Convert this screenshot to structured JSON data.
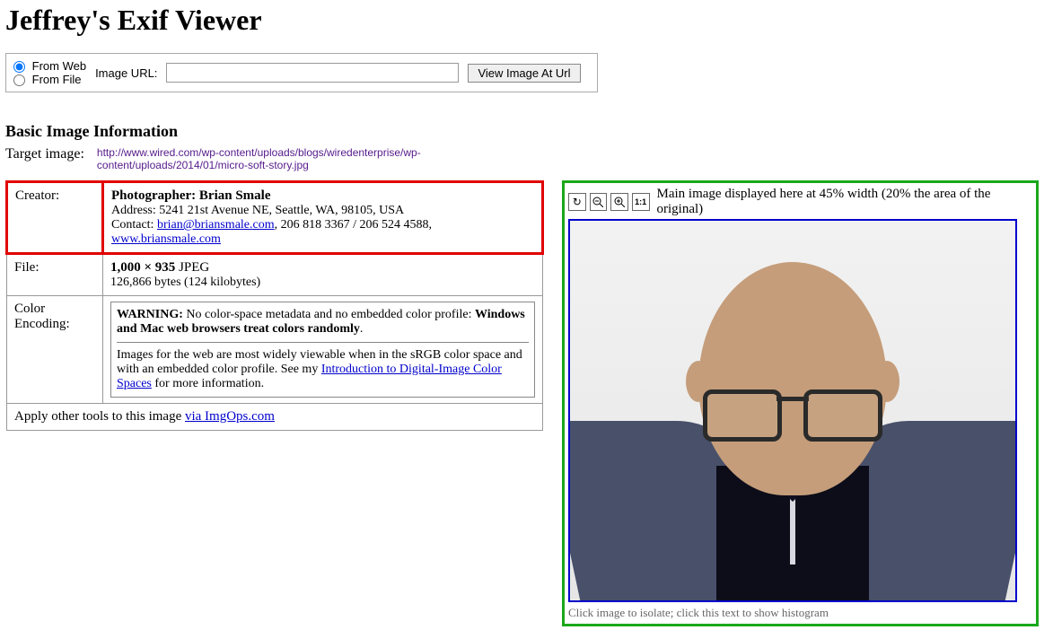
{
  "title": "Jeffrey's Exif Viewer",
  "source": {
    "from_web": "From Web",
    "from_file": "From File",
    "url_label": "Image URL:",
    "button": "View Image At Url"
  },
  "section_title": "Basic Image Information",
  "target": {
    "label": "Target image:",
    "url": "http://www.wired.com/wp-content/uploads/blogs/wiredenterprise/wp-content/uploads/2014/01/micro-soft-story.jpg"
  },
  "rows": {
    "creator": {
      "key": "Creator:",
      "photographer_label": "Photographer: Brian Smale",
      "address": "Address: 5241 21st Avenue NE, Seattle, WA, 98105, USA",
      "contact_prefix": "Contact: ",
      "email": "brian@briansmale.com",
      "phones": ", 206 818 3367 / 206 524 4588, ",
      "site": "www.briansmale.com"
    },
    "file": {
      "key": "File:",
      "dims": "1,000 × 935",
      "dims_suffix": " JPEG",
      "bytes": "126,866 bytes (124 kilobytes)"
    },
    "color": {
      "key": "Color Encoding:",
      "warn_bold1": "WARNING:",
      "warn_text1": " No color-space metadata and no embedded color profile: ",
      "warn_bold2": "Windows and Mac web browsers treat colors randomly",
      "period": ".",
      "body_pre": "Images for the web are most widely viewable when in the sRGB color space and with an embedded color profile. See my ",
      "body_link": "Introduction to Digital-Image Color Spaces",
      "body_post": " for more information."
    },
    "footer": {
      "pre": "Apply other tools to this image ",
      "link": "via ImgOps.com"
    }
  },
  "preview": {
    "caption": "Main image displayed here at 45% width (20% the area of the original)",
    "hint": "Click image to isolate; click this text to show histogram",
    "oneone": "1:1"
  }
}
